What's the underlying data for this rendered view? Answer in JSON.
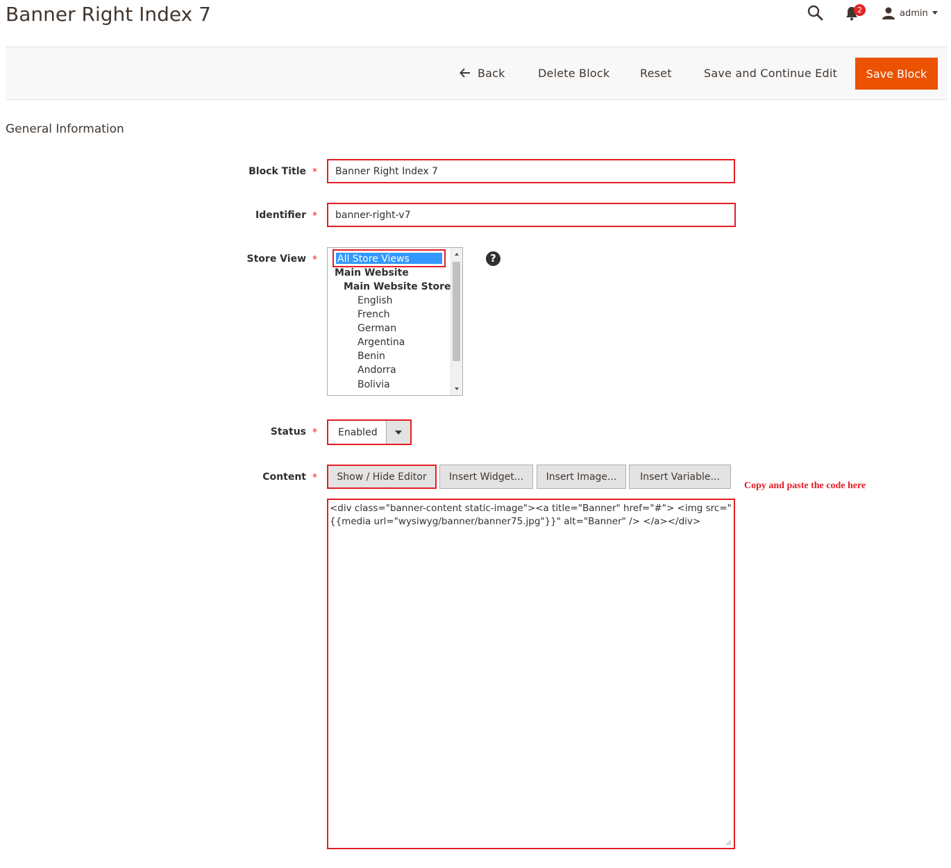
{
  "header": {
    "title": "Banner Right Index 7",
    "notification_count": "2",
    "user_name": "admin"
  },
  "actions": {
    "back": "Back",
    "delete": "Delete Block",
    "reset": "Reset",
    "save_continue": "Save and Continue Edit",
    "save": "Save Block"
  },
  "section": {
    "title": "General Information"
  },
  "form": {
    "block_title": {
      "label": "Block Title",
      "value": "Banner Right Index 7"
    },
    "identifier": {
      "label": "Identifier",
      "value": "banner-right-v7"
    },
    "store_view": {
      "label": "Store View",
      "selected": "All Store Views",
      "website": "Main Website",
      "store": "Main Website Store",
      "views": [
        "English",
        "French",
        "German",
        "Argentina",
        "Benin",
        "Andorra",
        "Bolivia"
      ]
    },
    "status": {
      "label": "Status",
      "value": "Enabled"
    },
    "content": {
      "label": "Content",
      "buttons": {
        "show_hide": "Show / Hide Editor",
        "insert_widget": "Insert Widget...",
        "insert_image": "Insert Image...",
        "insert_variable": "Insert Variable..."
      },
      "hint": "Copy and paste the code here",
      "value": "<div class=\"banner-content static-image\"><a title=\"Banner\" href=\"#\"> <img src=\"{{media url=\"wysiwyg/banner/banner75.jpg\"}}\" alt=\"Banner\" /> </a></div>"
    }
  },
  "colors": {
    "accent": "#eb5202",
    "highlight_border": "#e31d24",
    "selected_option": "#3399ff"
  },
  "icons": [
    "search-icon",
    "bell-icon",
    "user-icon",
    "caret-down-icon",
    "arrow-left-icon",
    "help-icon",
    "caret-down-icon"
  ]
}
